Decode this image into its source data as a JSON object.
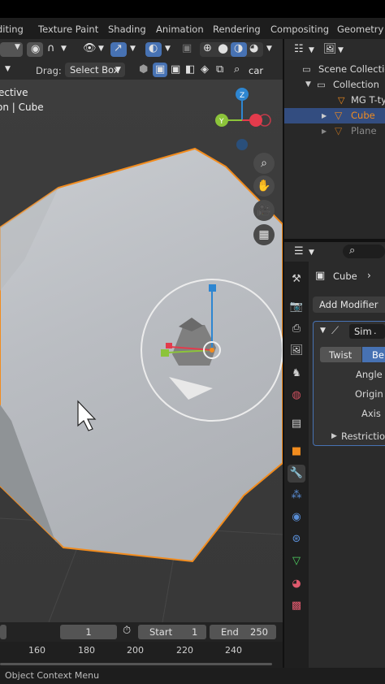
{
  "workspace_tabs": [
    "diting",
    "Texture Paint",
    "Shading",
    "Animation",
    "Rendering",
    "Compositing",
    "Geometry N"
  ],
  "viewport_header": {
    "drag_label": "Drag:",
    "select_mode": "Select Box",
    "search_value": "car"
  },
  "viewport": {
    "view_name": "ective",
    "object_info": "on | Cube",
    "gizmo_axes": {
      "x": "X",
      "y": "Y",
      "z": "Z"
    }
  },
  "outliner": {
    "items": [
      {
        "label": "Scene Collection",
        "icon": "scene-collection-icon"
      },
      {
        "label": "Collection",
        "icon": "collection-icon"
      },
      {
        "label": "MG T-typ",
        "icon": "mesh-icon"
      },
      {
        "label": "Cube",
        "icon": "modifier-wrench-icon",
        "selected": true
      },
      {
        "label": "Plane",
        "icon": "mesh-icon",
        "dimmed": true
      }
    ]
  },
  "properties": {
    "object_name": "Cube",
    "add_modifier_label": "Add Modifier",
    "modifier_name": "Sim",
    "mode_buttons": [
      "Twist",
      "Be"
    ],
    "fields": [
      "Angle",
      "Origin",
      "Axis"
    ],
    "restrictions_label": "Restriction"
  },
  "timeline": {
    "current_frame": "1",
    "start_label": "Start",
    "start_value": "1",
    "end_label": "End",
    "end_value": "250",
    "ticks": [
      "160",
      "180",
      "200",
      "220",
      "240"
    ]
  },
  "status_bar": {
    "text": "Object Context Menu"
  },
  "colors": {
    "accent_blue": "#4772b3",
    "selection_orange": "#f28c1e",
    "axis_x": "#e33b4c",
    "axis_y": "#8cc43a",
    "axis_z": "#2e86d1"
  }
}
